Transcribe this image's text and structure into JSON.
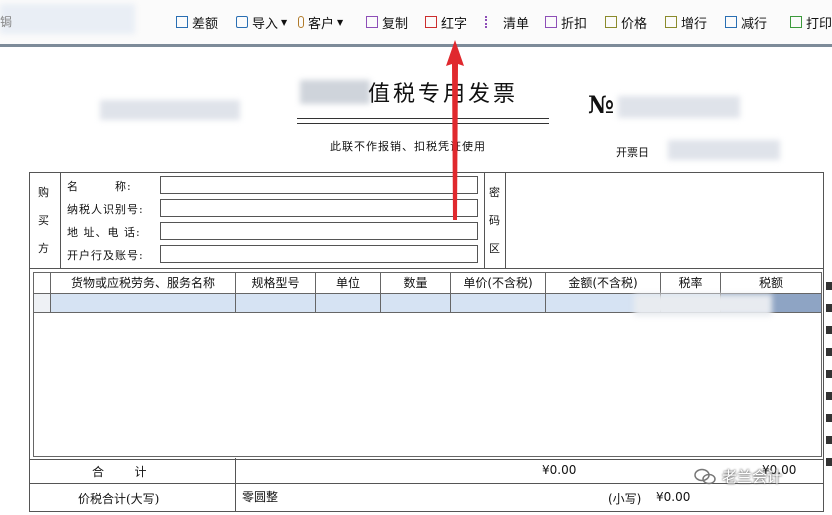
{
  "toolbar": {
    "left_fragment": "锔",
    "items": [
      {
        "label": "差额",
        "icon": "difference-icon"
      },
      {
        "label": "导入",
        "icon": "import-icon",
        "dropdown": true
      },
      {
        "label": "客户",
        "icon": "customer-icon",
        "dropdown": true
      },
      {
        "label": "复制",
        "icon": "copy-icon"
      },
      {
        "label": "红字",
        "icon": "red-invoice-icon"
      },
      {
        "label": "清单",
        "icon": "list-icon"
      },
      {
        "label": "折扣",
        "icon": "discount-icon"
      },
      {
        "label": "价格",
        "icon": "price-icon"
      },
      {
        "label": "增行",
        "icon": "add-row-icon"
      },
      {
        "label": "减行",
        "icon": "remove-row-icon"
      },
      {
        "label": "打印",
        "icon": "print-icon"
      }
    ]
  },
  "invoice": {
    "title": "值税专用发票",
    "subtitle": "此联不作报销、扣税凭证使用",
    "number_mark": "№",
    "date_label": "开票日",
    "buyer": {
      "side_label": [
        "购",
        "买",
        "方"
      ],
      "fields": [
        {
          "label": "名        称:",
          "value": ""
        },
        {
          "label": "纳税人识别号:",
          "value": ""
        },
        {
          "label": "地 址、电 话:",
          "value": ""
        },
        {
          "label": "开户行及账号:",
          "value": ""
        }
      ],
      "password_zone_label": [
        "密",
        "码",
        "区"
      ]
    },
    "items_table": {
      "columns": [
        "货物或应税劳务、服务名称",
        "规格型号",
        "单位",
        "数量",
        "单价(不含税)",
        "金额(不含税)",
        "税率",
        "税额"
      ],
      "rows": [
        [
          "",
          "",
          "",
          "",
          "",
          "",
          "",
          ""
        ]
      ]
    },
    "sum_row": {
      "label": "合        计",
      "amount": "¥0.00",
      "tax": "¥0.00"
    },
    "total_row": {
      "label": "价税合计(大写)",
      "uppercase_value": "零圆整",
      "small_label": "(小写)",
      "small_value": "¥0.00"
    }
  },
  "watermark": "老兰会计",
  "colors": {
    "toolbar_separator": "#7d8b99",
    "row_highlight": "#d6e3f3",
    "arrow": "#e0292e"
  }
}
